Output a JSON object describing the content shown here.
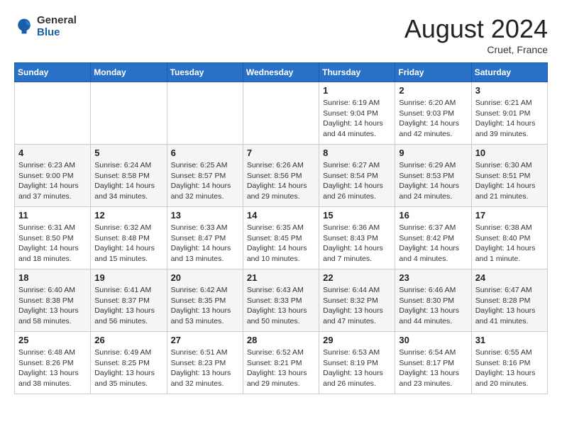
{
  "header": {
    "logo_general": "General",
    "logo_blue": "Blue",
    "month_year": "August 2024",
    "location": "Cruet, France"
  },
  "days_of_week": [
    "Sunday",
    "Monday",
    "Tuesday",
    "Wednesday",
    "Thursday",
    "Friday",
    "Saturday"
  ],
  "weeks": [
    [
      {
        "day": "",
        "info": ""
      },
      {
        "day": "",
        "info": ""
      },
      {
        "day": "",
        "info": ""
      },
      {
        "day": "",
        "info": ""
      },
      {
        "day": "1",
        "info": "Sunrise: 6:19 AM\nSunset: 9:04 PM\nDaylight: 14 hours\nand 44 minutes."
      },
      {
        "day": "2",
        "info": "Sunrise: 6:20 AM\nSunset: 9:03 PM\nDaylight: 14 hours\nand 42 minutes."
      },
      {
        "day": "3",
        "info": "Sunrise: 6:21 AM\nSunset: 9:01 PM\nDaylight: 14 hours\nand 39 minutes."
      }
    ],
    [
      {
        "day": "4",
        "info": "Sunrise: 6:23 AM\nSunset: 9:00 PM\nDaylight: 14 hours\nand 37 minutes."
      },
      {
        "day": "5",
        "info": "Sunrise: 6:24 AM\nSunset: 8:58 PM\nDaylight: 14 hours\nand 34 minutes."
      },
      {
        "day": "6",
        "info": "Sunrise: 6:25 AM\nSunset: 8:57 PM\nDaylight: 14 hours\nand 32 minutes."
      },
      {
        "day": "7",
        "info": "Sunrise: 6:26 AM\nSunset: 8:56 PM\nDaylight: 14 hours\nand 29 minutes."
      },
      {
        "day": "8",
        "info": "Sunrise: 6:27 AM\nSunset: 8:54 PM\nDaylight: 14 hours\nand 26 minutes."
      },
      {
        "day": "9",
        "info": "Sunrise: 6:29 AM\nSunset: 8:53 PM\nDaylight: 14 hours\nand 24 minutes."
      },
      {
        "day": "10",
        "info": "Sunrise: 6:30 AM\nSunset: 8:51 PM\nDaylight: 14 hours\nand 21 minutes."
      }
    ],
    [
      {
        "day": "11",
        "info": "Sunrise: 6:31 AM\nSunset: 8:50 PM\nDaylight: 14 hours\nand 18 minutes."
      },
      {
        "day": "12",
        "info": "Sunrise: 6:32 AM\nSunset: 8:48 PM\nDaylight: 14 hours\nand 15 minutes."
      },
      {
        "day": "13",
        "info": "Sunrise: 6:33 AM\nSunset: 8:47 PM\nDaylight: 14 hours\nand 13 minutes."
      },
      {
        "day": "14",
        "info": "Sunrise: 6:35 AM\nSunset: 8:45 PM\nDaylight: 14 hours\nand 10 minutes."
      },
      {
        "day": "15",
        "info": "Sunrise: 6:36 AM\nSunset: 8:43 PM\nDaylight: 14 hours\nand 7 minutes."
      },
      {
        "day": "16",
        "info": "Sunrise: 6:37 AM\nSunset: 8:42 PM\nDaylight: 14 hours\nand 4 minutes."
      },
      {
        "day": "17",
        "info": "Sunrise: 6:38 AM\nSunset: 8:40 PM\nDaylight: 14 hours\nand 1 minute."
      }
    ],
    [
      {
        "day": "18",
        "info": "Sunrise: 6:40 AM\nSunset: 8:38 PM\nDaylight: 13 hours\nand 58 minutes."
      },
      {
        "day": "19",
        "info": "Sunrise: 6:41 AM\nSunset: 8:37 PM\nDaylight: 13 hours\nand 56 minutes."
      },
      {
        "day": "20",
        "info": "Sunrise: 6:42 AM\nSunset: 8:35 PM\nDaylight: 13 hours\nand 53 minutes."
      },
      {
        "day": "21",
        "info": "Sunrise: 6:43 AM\nSunset: 8:33 PM\nDaylight: 13 hours\nand 50 minutes."
      },
      {
        "day": "22",
        "info": "Sunrise: 6:44 AM\nSunset: 8:32 PM\nDaylight: 13 hours\nand 47 minutes."
      },
      {
        "day": "23",
        "info": "Sunrise: 6:46 AM\nSunset: 8:30 PM\nDaylight: 13 hours\nand 44 minutes."
      },
      {
        "day": "24",
        "info": "Sunrise: 6:47 AM\nSunset: 8:28 PM\nDaylight: 13 hours\nand 41 minutes."
      }
    ],
    [
      {
        "day": "25",
        "info": "Sunrise: 6:48 AM\nSunset: 8:26 PM\nDaylight: 13 hours\nand 38 minutes."
      },
      {
        "day": "26",
        "info": "Sunrise: 6:49 AM\nSunset: 8:25 PM\nDaylight: 13 hours\nand 35 minutes."
      },
      {
        "day": "27",
        "info": "Sunrise: 6:51 AM\nSunset: 8:23 PM\nDaylight: 13 hours\nand 32 minutes."
      },
      {
        "day": "28",
        "info": "Sunrise: 6:52 AM\nSunset: 8:21 PM\nDaylight: 13 hours\nand 29 minutes."
      },
      {
        "day": "29",
        "info": "Sunrise: 6:53 AM\nSunset: 8:19 PM\nDaylight: 13 hours\nand 26 minutes."
      },
      {
        "day": "30",
        "info": "Sunrise: 6:54 AM\nSunset: 8:17 PM\nDaylight: 13 hours\nand 23 minutes."
      },
      {
        "day": "31",
        "info": "Sunrise: 6:55 AM\nSunset: 8:16 PM\nDaylight: 13 hours\nand 20 minutes."
      }
    ]
  ]
}
